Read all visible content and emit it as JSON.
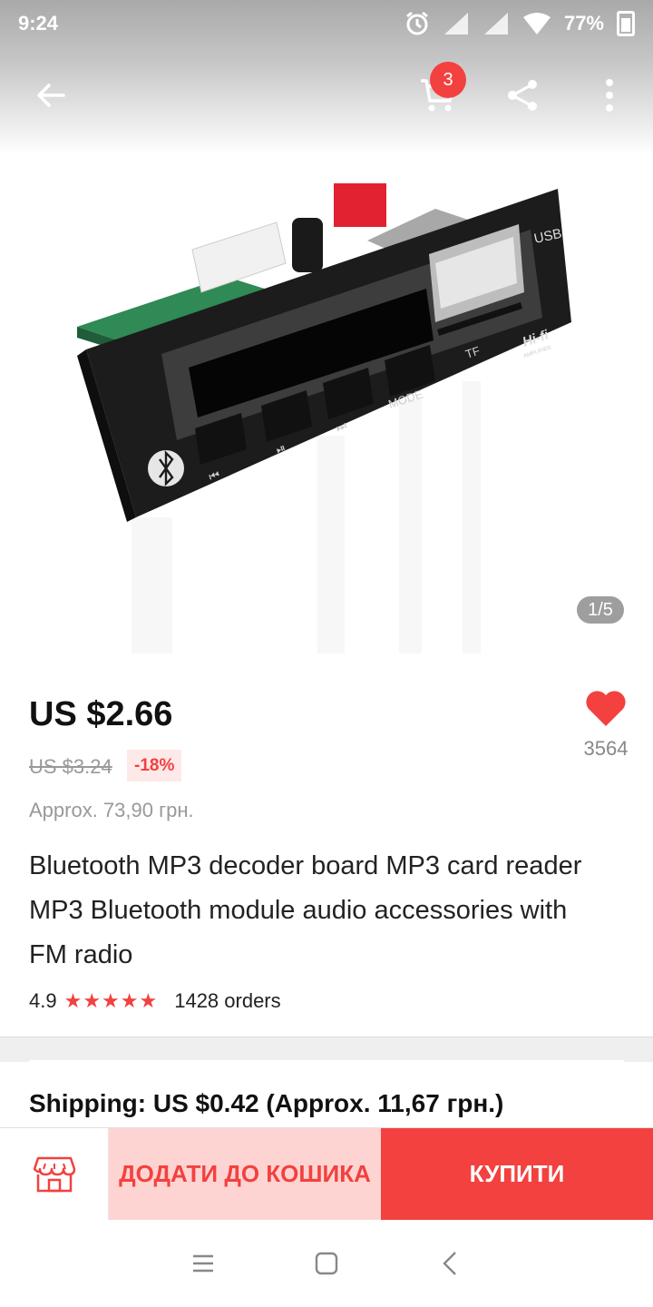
{
  "status": {
    "time": "9:24",
    "battery": "77%"
  },
  "header": {
    "cart_count": "3"
  },
  "gallery": {
    "pager": "1/5"
  },
  "product": {
    "price": "US $2.66",
    "old_price": "US $3.24",
    "discount": "-18%",
    "approx": "Approx. 73,90 грн.",
    "wishlist_count": "3564",
    "title": "Bluetooth MP3 decoder board MP3 card reader MP3 Bluetooth module audio accessories with FM radio",
    "rating": "4.9",
    "stars": "★★★★★",
    "orders": "1428 orders"
  },
  "board_labels": {
    "usb": "USB",
    "hifi": "Hi-fi",
    "amplifier": "AMPLIFIER",
    "tf": "TF",
    "mode": "MODE"
  },
  "shipping": {
    "text": "Shipping: US $0.42 (Approx. 11,67 грн.)"
  },
  "actions": {
    "add_to_cart": "ДОДАТИ ДО КОШИКА",
    "buy": "КУПИТИ"
  },
  "colors": {
    "accent": "#f2413f",
    "accent_light": "#fdd4d2"
  },
  "icons": [
    "back-arrow-icon",
    "cart-icon",
    "share-icon",
    "more-vertical-icon",
    "heart-icon",
    "store-icon",
    "menu-icon",
    "home-square-icon",
    "nav-back-icon"
  ]
}
